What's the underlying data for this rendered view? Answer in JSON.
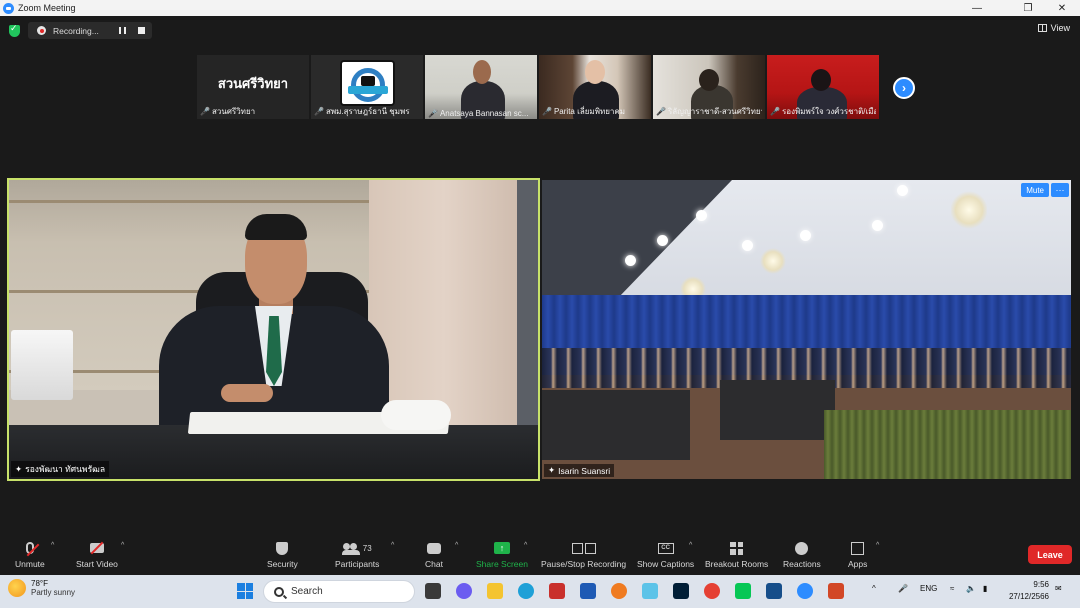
{
  "window": {
    "title": "Zoom Meeting"
  },
  "header": {
    "recording_label": "Recording...",
    "view_label": "View"
  },
  "thumbnails": [
    {
      "name": "สวนศรีวิทยา",
      "tile_text": "สวนศรีวิทยา"
    },
    {
      "name": "สพม.สุราษฎร์ธานี ชุมพร"
    },
    {
      "name": "Anatsaya Bannasan sc..."
    },
    {
      "name": "Parita เลี่ยมพิทยาคม"
    },
    {
      "name": "ริลัญญาราชาดี-สวนศรีวิทยา"
    },
    {
      "name": "รองพิมพร์ใจ วงศ์วรชาติ/เมือ..."
    }
  ],
  "main_tiles": {
    "left_name": "รองพัฒนา ทัศนพรัฒล",
    "right_name": "Isarin Suansri",
    "mute_label": "Mute",
    "more_label": "···"
  },
  "toolbar": {
    "unmute": "Unmute",
    "start_video": "Start Video",
    "security": "Security",
    "participants": "Participants",
    "participants_count": "73",
    "chat": "Chat",
    "share_screen": "Share Screen",
    "pause_stop_recording": "Pause/Stop Recording",
    "show_captions": "Show Captions",
    "breakout_rooms": "Breakout Rooms",
    "reactions": "Reactions",
    "apps": "Apps",
    "leave": "Leave"
  },
  "taskbar": {
    "temperature": "78°F",
    "weather": "Partly sunny",
    "search_placeholder": "Search",
    "language": "ENG",
    "time": "9:56",
    "date": "27/12/2566"
  },
  "colors": {
    "zoom_blue": "#2d8cff",
    "leave_red": "#e02828",
    "share_green": "#1fb34a",
    "active_speaker_border": "#c8e26a"
  }
}
